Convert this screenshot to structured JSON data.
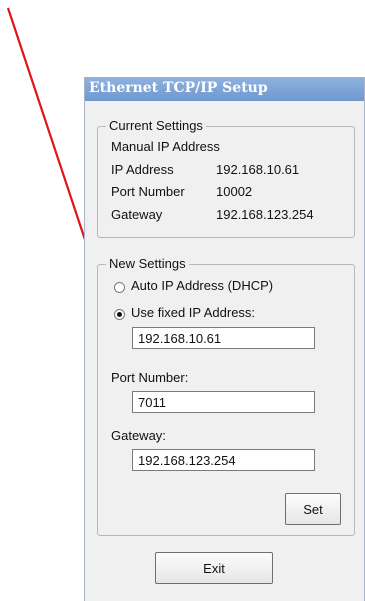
{
  "window": {
    "title": "Ethernet TCP/IP Setup"
  },
  "current": {
    "legend": "Current Settings",
    "mode": "Manual IP Address",
    "rows": [
      {
        "label": "IP Address",
        "value": "192.168.10.61"
      },
      {
        "label": "Port Number",
        "value": "10002"
      },
      {
        "label": "Gateway",
        "value": "192.168.123.254"
      }
    ]
  },
  "new": {
    "legend": "New Settings",
    "dhcp_label": "Auto IP Address (DHCP)",
    "fixed_label": "Use fixed IP Address:",
    "selected": "fixed",
    "ip_value": "192.168.10.61",
    "port_label": "Port Number:",
    "port_value": "7011",
    "gateway_label": "Gateway:",
    "gateway_value": "192.168.123.254",
    "set_label": "Set"
  },
  "exit_label": "Exit",
  "colors": {
    "arrow": "#e0141a",
    "title_bar": "#7ea5d8"
  }
}
